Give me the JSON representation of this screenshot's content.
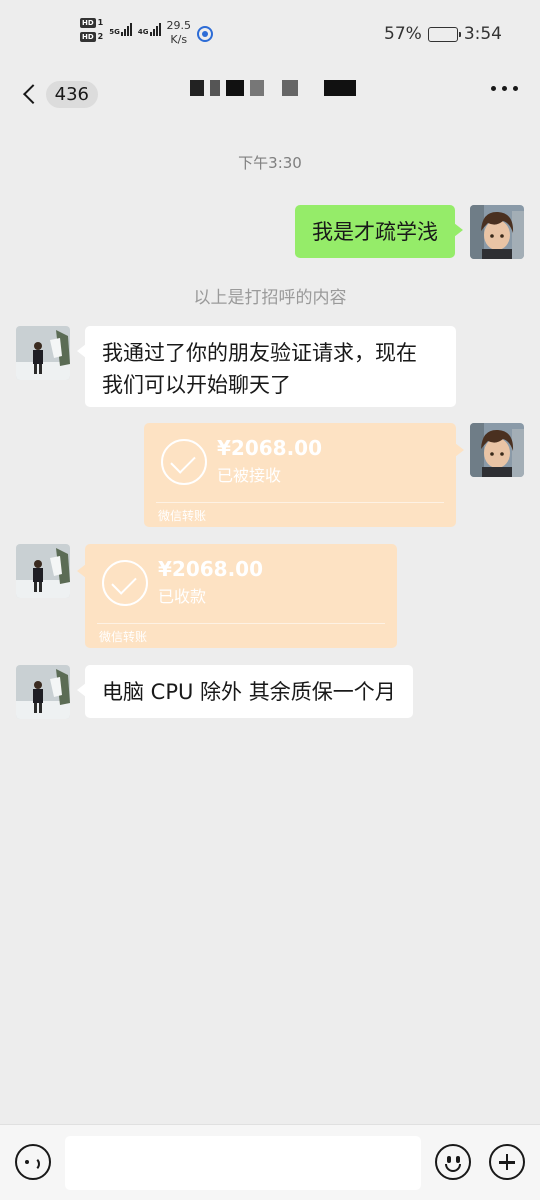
{
  "status_bar": {
    "hd1": "HD",
    "hd1_num": "1",
    "hd2": "HD",
    "hd2_num": "2",
    "net1": "5G",
    "net2": "4G",
    "speed_value": "29.5",
    "speed_unit": "K/s",
    "battery_percent": "57%",
    "battery_level": 0.57,
    "time": "3:54"
  },
  "nav": {
    "unread_count": "436",
    "back_icon": "chevron-left-icon",
    "more_icon": "more-dots-icon"
  },
  "chat": {
    "timestamp": "下午3:30",
    "system_notice": "以上是打招呼的内容",
    "messages": [
      {
        "sender": "me",
        "type": "text",
        "text": "我是才疏学浅"
      },
      {
        "sender": "them",
        "type": "text",
        "line1": "我通过了你的朋友验证请求，现在",
        "line2": "我们可以开始聊天了"
      },
      {
        "sender": "me",
        "type": "transfer",
        "amount": "¥2068.00",
        "status": "已被接收",
        "footer": "微信转账"
      },
      {
        "sender": "them",
        "type": "transfer",
        "amount": "¥2068.00",
        "status": "已收款",
        "footer": "微信转账"
      },
      {
        "sender": "them",
        "type": "text",
        "text": "电脑 CPU 除外 其余质保一个月"
      }
    ]
  },
  "input_bar": {
    "voice_icon": "voice-icon",
    "emoji_icon": "emoji-icon",
    "plus_icon": "plus-icon",
    "placeholder": ""
  },
  "colors": {
    "background": "#ededed",
    "my_bubble": "#95ec69",
    "their_bubble": "#ffffff",
    "transfer": "#fde2c3"
  }
}
